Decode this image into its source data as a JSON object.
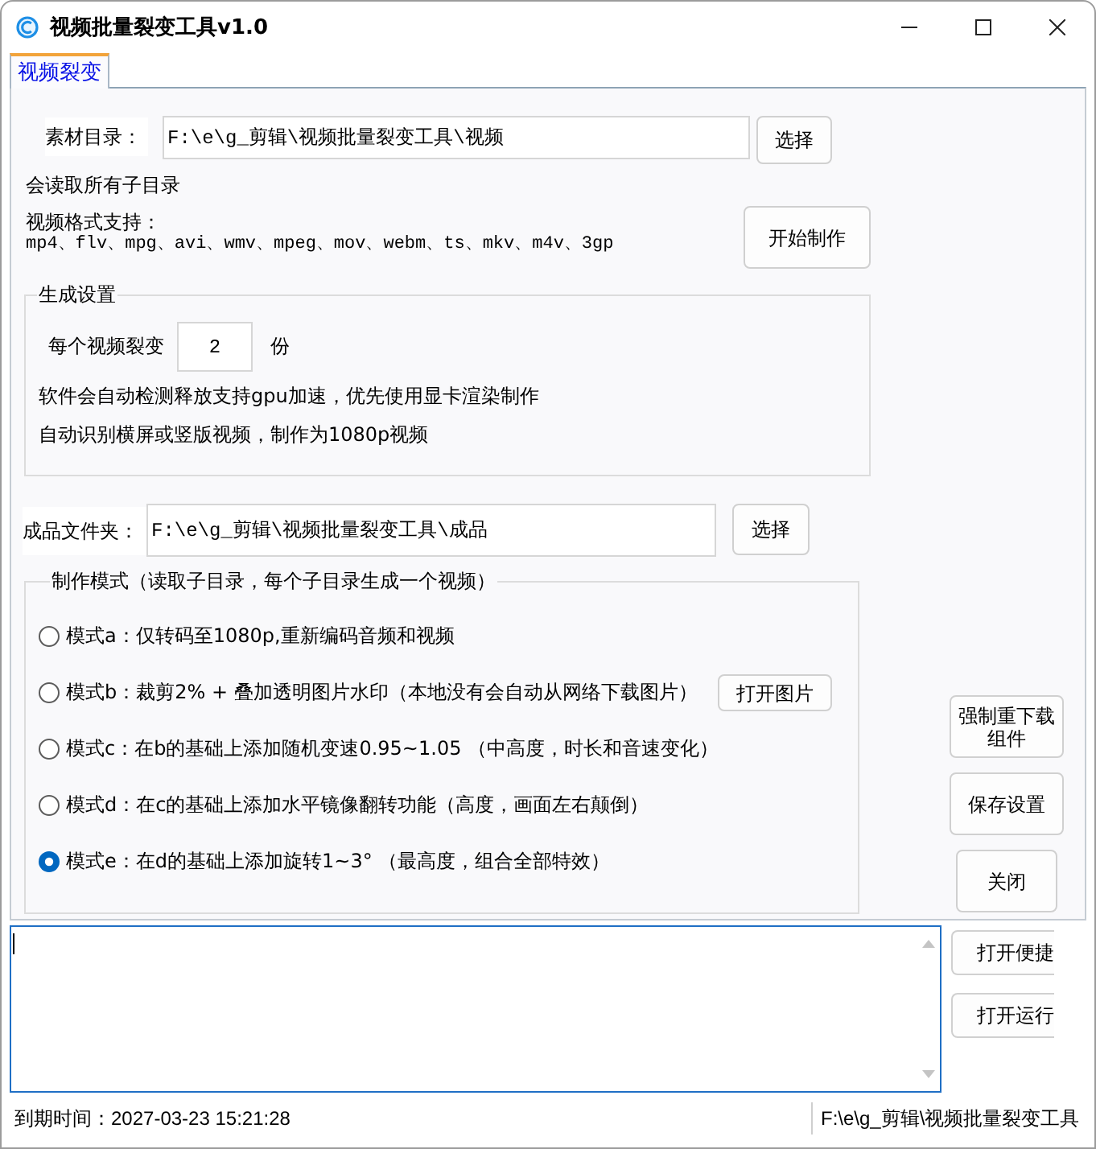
{
  "window": {
    "title": "视频批量裂变工具v1.0"
  },
  "tabs": [
    {
      "label": "视频裂变",
      "selected": true
    }
  ],
  "source_folder": {
    "label": "素材目录：",
    "value": "F:\\e\\g_剪辑\\视频批量裂变工具\\视频",
    "button": "选择"
  },
  "subfolder_note": "会读取所有子目录",
  "formats": {
    "label": "视频格式支持：",
    "list": "mp4、flv、mpg、avi、wmv、mpeg、mov、webm、ts、mkv、m4v、3gp"
  },
  "start_button": "开始制作",
  "settings": {
    "title": "生成设置",
    "split_label": "每个视频裂变",
    "split_count": "2",
    "split_unit": "份",
    "notes": [
      "软件会自动检测释放支持gpu加速，优先使用显卡渲染制作",
      "自动识别横屏或竖版视频，制作为1080p视频"
    ]
  },
  "output_folder": {
    "label": "成品文件夹：",
    "value": "F:\\e\\g_剪辑\\视频批量裂变工具\\成品",
    "button": "选择"
  },
  "mode_group": {
    "title": "制作模式（读取子目录，每个子目录生成一个视频）",
    "modes": [
      {
        "label": "模式a：仅转码至1080p,重新编码音频和视频",
        "selected": false
      },
      {
        "label": "模式b：裁剪2% + 叠加透明图片水印（本地没有会自动从网络下载图片）",
        "selected": false,
        "button": "打开图片"
      },
      {
        "label": "模式c：在b的基础上添加随机变速0.95~1.05 （中高度，时长和音速变化）",
        "selected": false
      },
      {
        "label": "模式d：在c的基础上添加水平镜像翻转功能（高度，画面左右颠倒）",
        "selected": false
      },
      {
        "label": "模式e：在d的基础上添加旋转1~3° （最高度，组合全部特效）",
        "selected": true
      }
    ]
  },
  "side_buttons": [
    "强制重下载组件",
    "保存设置",
    "关闭"
  ],
  "log_buttons": [
    "打开便捷",
    "打开运行"
  ],
  "status_bar": {
    "expiry": "到期时间：2027-03-23 15:21:28",
    "path": "F:\\e\\g_剪辑\\视频批量裂变工具"
  }
}
